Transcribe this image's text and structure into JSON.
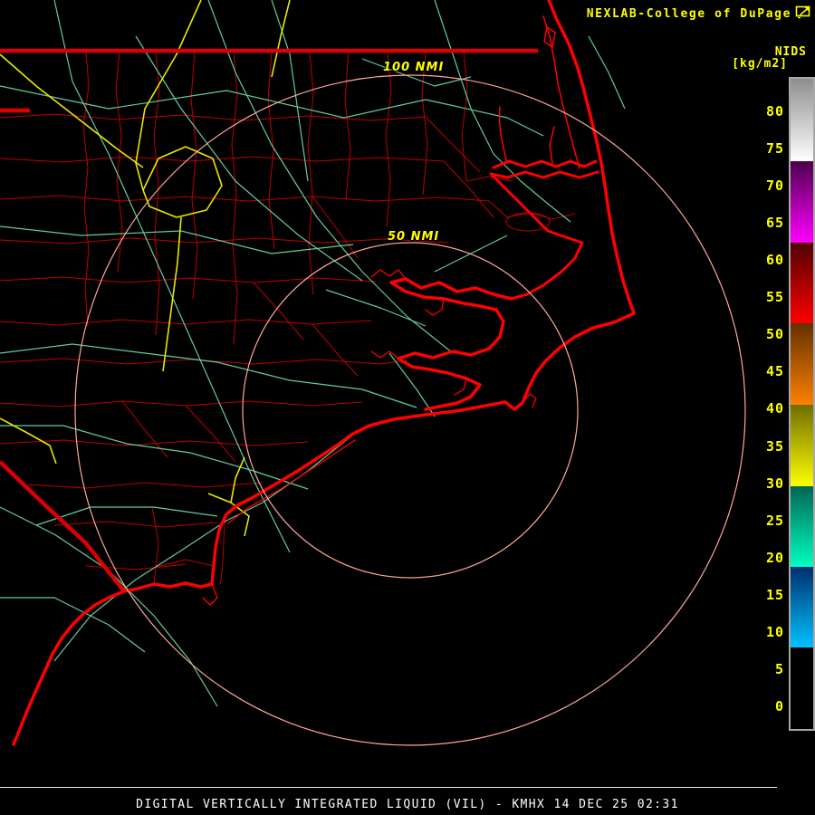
{
  "header": {
    "brand": "NEXLAB-College of DuPage",
    "logo": "cod-flag-icon"
  },
  "colorbar": {
    "title": "NIDS",
    "units": "[kg/m2]",
    "tick_labels": [
      "80",
      "75",
      "70",
      "65",
      "60",
      "55",
      "50",
      "45",
      "40",
      "35",
      "30",
      "25",
      "20",
      "15",
      "10",
      "5",
      "0"
    ],
    "segments": [
      {
        "top": "#8e8e8e",
        "bottom": "#ffffff"
      },
      {
        "top": "#4c004c",
        "bottom": "#ff00ff"
      },
      {
        "top": "#500000",
        "bottom": "#ff0000"
      },
      {
        "top": "#643000",
        "bottom": "#ff8000"
      },
      {
        "top": "#6e6e00",
        "bottom": "#ffff00"
      },
      {
        "top": "#006652",
        "bottom": "#00ffc2"
      },
      {
        "top": "#002e6e",
        "bottom": "#00c2ff"
      },
      {
        "top": "#000000",
        "bottom": "#000000"
      }
    ]
  },
  "map": {
    "range_labels": {
      "outer": "100 NMI",
      "inner": "50 NMI"
    },
    "radar_site": "KMHX",
    "colors": {
      "county_lines": "#c00000",
      "state_border": "#dd0000",
      "coastline": "#ff0000",
      "roads_secondary": "#66cc99",
      "roads_interstate": "#e8e800",
      "range_rings": "#ffa89a",
      "labels": "#ffff00"
    }
  },
  "caption": {
    "text": "DIGITAL VERTICALLY INTEGRATED LIQUID (VIL) - KMHX 14 DEC 25 02:31"
  }
}
